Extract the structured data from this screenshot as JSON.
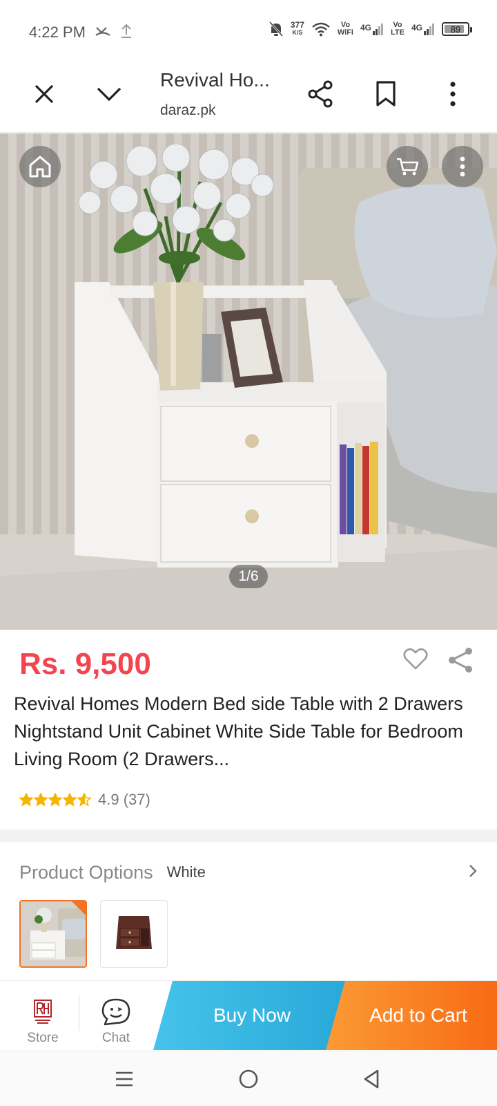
{
  "status_bar": {
    "time": "4:22 PM",
    "net_speed_value": "377",
    "net_speed_unit": "K/S",
    "vowifi_top": "Vo",
    "vowifi_bottom": "WiFi",
    "sim1_type": "4G",
    "volte_top": "Vo",
    "volte_bottom": "LTE",
    "sim2_type": "4G",
    "battery_level": 89
  },
  "browser": {
    "page_title": "Revival Ho...",
    "domain": "daraz.pk"
  },
  "hero": {
    "image_counter": "1/6"
  },
  "product": {
    "price": "Rs. 9,500",
    "title": "Revival Homes Modern Bed side Table with 2 Drawers Nightstand Unit Cabinet White Side Table for Bedroom Living Room (2 Drawers...",
    "rating_value": 4.9,
    "rating_text": "4.9 (37)"
  },
  "options": {
    "label": "Product Options",
    "selected_value": "White"
  },
  "action_bar": {
    "store_label": "Store",
    "chat_label": "Chat",
    "buy_now_label": "Buy Now",
    "add_to_cart_label": "Add to Cart"
  },
  "colors": {
    "price": "#f3454f",
    "buy_now": "#2aa9da",
    "add_to_cart": "#f86b16",
    "selected_border": "#f57224",
    "star": "#f5b400"
  }
}
